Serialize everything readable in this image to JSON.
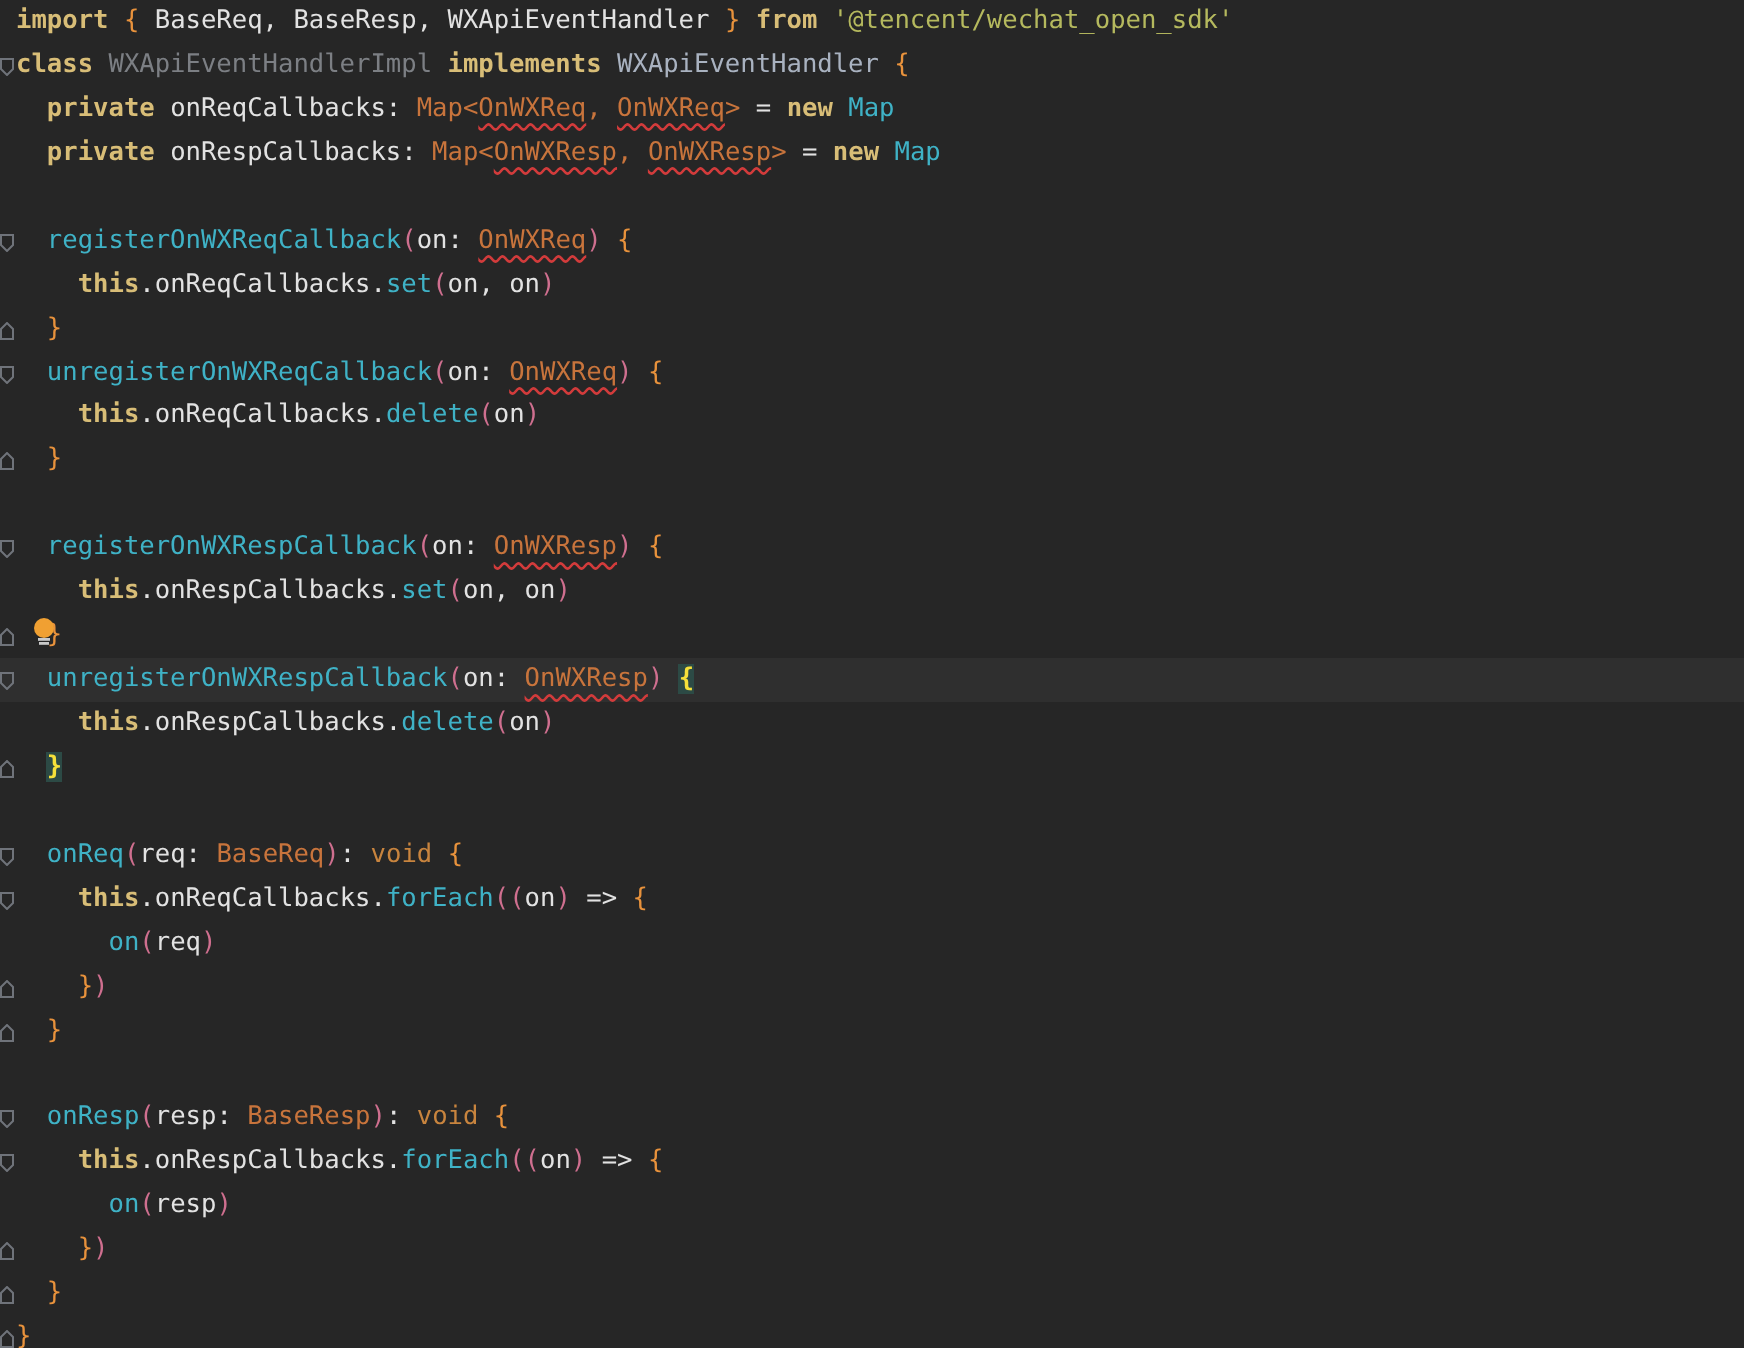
{
  "editor": {
    "blocks": [
      {
        "lines": [
          {
            "tokens": [
              {
                "kind": "keyword",
                "text": "import"
              },
              {
                "kind": "brace",
                "text": " {"
              },
              {
                "kind": "plain",
                "text": " BaseReq, BaseResp, WXApiEventHandler "
              },
              {
                "kind": "brace",
                "text": "}"
              },
              {
                "kind": "keyword",
                "text": " from"
              },
              {
                "kind": "string",
                "text": " '@tencent/wechat_open_sdk'"
              }
            ]
          },
          {
            "fold_marker": {
              "kind": "start"
            },
            "tokens": [
              {
                "kind": "keyword",
                "text": "class"
              },
              {
                "kind": "unused",
                "text": " WXApiEventHandlerImpl"
              },
              {
                "kind": "keyword",
                "text": " implements"
              },
              {
                "kind": "interface",
                "text": " WXApiEventHandler"
              },
              {
                "kind": "brace",
                "text": " {"
              }
            ]
          },
          {
            "tokens": [
              {
                "kind": "keyword",
                "text": "  private"
              },
              {
                "kind": "plain",
                "text": " onReqCallbacks: "
              },
              {
                "kind": "type",
                "text": "Map<"
              },
              {
                "kind": "type",
                "text": "OnWXReq",
                "error": true
              },
              {
                "kind": "type",
                "text": ", "
              },
              {
                "kind": "type",
                "text": "OnWXReq",
                "error": true
              },
              {
                "kind": "type",
                "text": ">"
              },
              {
                "kind": "plain",
                "text": " = "
              },
              {
                "kind": "keyword",
                "text": "new"
              },
              {
                "kind": "function",
                "text": " Map"
              }
            ]
          },
          {
            "tokens": [
              {
                "kind": "keyword",
                "text": "  private"
              },
              {
                "kind": "plain",
                "text": " onRespCallbacks: "
              },
              {
                "kind": "type",
                "text": "Map<"
              },
              {
                "kind": "type",
                "text": "OnWXResp",
                "error": true
              },
              {
                "kind": "type",
                "text": ", "
              },
              {
                "kind": "type",
                "text": "OnWXResp",
                "error": true
              },
              {
                "kind": "type",
                "text": ">"
              },
              {
                "kind": "plain",
                "text": " = "
              },
              {
                "kind": "keyword",
                "text": "new"
              },
              {
                "kind": "function",
                "text": " Map"
              }
            ]
          }
        ]
      },
      {
        "lines": [
          {
            "fold_marker": {
              "kind": "start"
            },
            "tokens": [
              {
                "kind": "function",
                "text": "  registerOnWXReqCallback"
              },
              {
                "kind": "paren",
                "text": "("
              },
              {
                "kind": "plain",
                "text": "on: "
              },
              {
                "kind": "type",
                "text": "OnWXReq",
                "error": true
              },
              {
                "kind": "paren",
                "text": ")"
              },
              {
                "kind": "brace",
                "text": " {"
              }
            ]
          },
          {
            "tokens": [
              {
                "kind": "keyword",
                "text": "    this"
              },
              {
                "kind": "plain",
                "text": ".onReqCallbacks."
              },
              {
                "kind": "function",
                "text": "set"
              },
              {
                "kind": "paren",
                "text": "("
              },
              {
                "kind": "plain",
                "text": "on, on"
              },
              {
                "kind": "paren",
                "text": ")"
              }
            ]
          },
          {
            "fold_marker": {
              "kind": "end"
            },
            "tokens": [
              {
                "kind": "brace",
                "text": "  }"
              }
            ]
          },
          {
            "fold_marker": {
              "kind": "start"
            },
            "tokens": [
              {
                "kind": "function",
                "text": "  unregisterOnWXReqCallback"
              },
              {
                "kind": "paren",
                "text": "("
              },
              {
                "kind": "plain",
                "text": "on: "
              },
              {
                "kind": "type",
                "text": "OnWXReq",
                "error": true
              },
              {
                "kind": "paren",
                "text": ")"
              },
              {
                "kind": "brace",
                "text": " {"
              }
            ]
          },
          {
            "tokens": [
              {
                "kind": "keyword",
                "text": "    this"
              },
              {
                "kind": "plain",
                "text": ".onReqCallbacks."
              },
              {
                "kind": "function",
                "text": "delete"
              },
              {
                "kind": "paren",
                "text": "("
              },
              {
                "kind": "plain",
                "text": "on"
              },
              {
                "kind": "paren",
                "text": ")"
              }
            ]
          },
          {
            "fold_marker": {
              "kind": "end"
            },
            "tokens": [
              {
                "kind": "brace",
                "text": "  }"
              }
            ]
          }
        ]
      },
      {
        "lines": [
          {
            "fold_marker": {
              "kind": "start"
            },
            "tokens": [
              {
                "kind": "function",
                "text": "  registerOnWXRespCallback"
              },
              {
                "kind": "paren",
                "text": "("
              },
              {
                "kind": "plain",
                "text": "on: "
              },
              {
                "kind": "type",
                "text": "OnWXResp",
                "error": true
              },
              {
                "kind": "paren",
                "text": ")"
              },
              {
                "kind": "brace",
                "text": " {"
              }
            ]
          },
          {
            "tokens": [
              {
                "kind": "keyword",
                "text": "    this"
              },
              {
                "kind": "plain",
                "text": ".onRespCallbacks."
              },
              {
                "kind": "function",
                "text": "set"
              },
              {
                "kind": "paren",
                "text": "("
              },
              {
                "kind": "plain",
                "text": "on, on"
              },
              {
                "kind": "paren",
                "text": ")"
              }
            ]
          },
          {
            "fold_marker": {
              "kind": "end"
            },
            "intention": true,
            "tokens": [
              {
                "kind": "brace",
                "text": "  }"
              }
            ]
          },
          {
            "fold_marker": {
              "kind": "start"
            },
            "current": true,
            "tokens": [
              {
                "kind": "function",
                "text": "  unregisterOnWXRespCallback"
              },
              {
                "kind": "paren",
                "text": "("
              },
              {
                "kind": "plain",
                "text": "on: "
              },
              {
                "kind": "type",
                "text": "OnWXResp",
                "error": true
              },
              {
                "kind": "paren",
                "text": ") "
              },
              {
                "kind": "brace",
                "text": "{",
                "matched": true
              }
            ]
          },
          {
            "tokens": [
              {
                "kind": "keyword",
                "text": "    this"
              },
              {
                "kind": "plain",
                "text": ".onRespCallbacks."
              },
              {
                "kind": "function",
                "text": "delete"
              },
              {
                "kind": "paren",
                "text": "("
              },
              {
                "kind": "plain",
                "text": "on"
              },
              {
                "kind": "paren",
                "text": ")"
              }
            ]
          },
          {
            "fold_marker": {
              "kind": "end"
            },
            "tokens": [
              {
                "kind": "brace",
                "text": "  }",
                "matched": true
              }
            ]
          }
        ]
      },
      {
        "lines": [
          {
            "fold_marker": {
              "kind": "start"
            },
            "tokens": [
              {
                "kind": "function",
                "text": "  onReq"
              },
              {
                "kind": "paren",
                "text": "("
              },
              {
                "kind": "plain",
                "text": "req: "
              },
              {
                "kind": "type",
                "text": "BaseReq"
              },
              {
                "kind": "paren",
                "text": ")"
              },
              {
                "kind": "plain",
                "text": ": "
              },
              {
                "kind": "primitive",
                "text": "void"
              },
              {
                "kind": "brace",
                "text": " {"
              }
            ]
          },
          {
            "fold_marker": {
              "kind": "start"
            },
            "tokens": [
              {
                "kind": "keyword",
                "text": "    this"
              },
              {
                "kind": "plain",
                "text": ".onReqCallbacks."
              },
              {
                "kind": "function",
                "text": "forEach"
              },
              {
                "kind": "paren",
                "text": "(("
              },
              {
                "kind": "plain",
                "text": "on"
              },
              {
                "kind": "paren",
                "text": ")"
              },
              {
                "kind": "plain",
                "text": " => "
              },
              {
                "kind": "brace",
                "text": "{"
              }
            ]
          },
          {
            "tokens": [
              {
                "kind": "function",
                "text": "      on"
              },
              {
                "kind": "paren",
                "text": "("
              },
              {
                "kind": "plain",
                "text": "req"
              },
              {
                "kind": "paren",
                "text": ")"
              }
            ]
          },
          {
            "fold_marker": {
              "kind": "end"
            },
            "tokens": [
              {
                "kind": "brace",
                "text": "    }"
              },
              {
                "kind": "paren",
                "text": ")"
              }
            ]
          },
          {
            "fold_marker": {
              "kind": "end"
            },
            "tokens": [
              {
                "kind": "brace",
                "text": "  }"
              }
            ]
          }
        ]
      },
      {
        "lines": [
          {
            "fold_marker": {
              "kind": "start"
            },
            "tokens": [
              {
                "kind": "function",
                "text": "  onResp"
              },
              {
                "kind": "paren",
                "text": "("
              },
              {
                "kind": "plain",
                "text": "resp: "
              },
              {
                "kind": "type",
                "text": "BaseResp"
              },
              {
                "kind": "paren",
                "text": ")"
              },
              {
                "kind": "plain",
                "text": ": "
              },
              {
                "kind": "primitive",
                "text": "void"
              },
              {
                "kind": "brace",
                "text": " {"
              }
            ]
          },
          {
            "fold_marker": {
              "kind": "start"
            },
            "tokens": [
              {
                "kind": "keyword",
                "text": "    this"
              },
              {
                "kind": "plain",
                "text": ".onRespCallbacks."
              },
              {
                "kind": "function",
                "text": "forEach"
              },
              {
                "kind": "paren",
                "text": "(("
              },
              {
                "kind": "plain",
                "text": "on"
              },
              {
                "kind": "paren",
                "text": ")"
              },
              {
                "kind": "plain",
                "text": " => "
              },
              {
                "kind": "brace",
                "text": "{"
              }
            ]
          },
          {
            "tokens": [
              {
                "kind": "function",
                "text": "      on"
              },
              {
                "kind": "paren",
                "text": "("
              },
              {
                "kind": "plain",
                "text": "resp"
              },
              {
                "kind": "paren",
                "text": ")"
              }
            ]
          },
          {
            "fold_marker": {
              "kind": "end"
            },
            "tokens": [
              {
                "kind": "brace",
                "text": "    }"
              },
              {
                "kind": "paren",
                "text": ")"
              }
            ]
          },
          {
            "fold_marker": {
              "kind": "end"
            },
            "tokens": [
              {
                "kind": "brace",
                "text": "  }"
              }
            ]
          },
          {
            "fold_marker": {
              "kind": "end"
            },
            "tokens": [
              {
                "kind": "brace",
                "text": "}"
              }
            ]
          }
        ]
      }
    ]
  }
}
